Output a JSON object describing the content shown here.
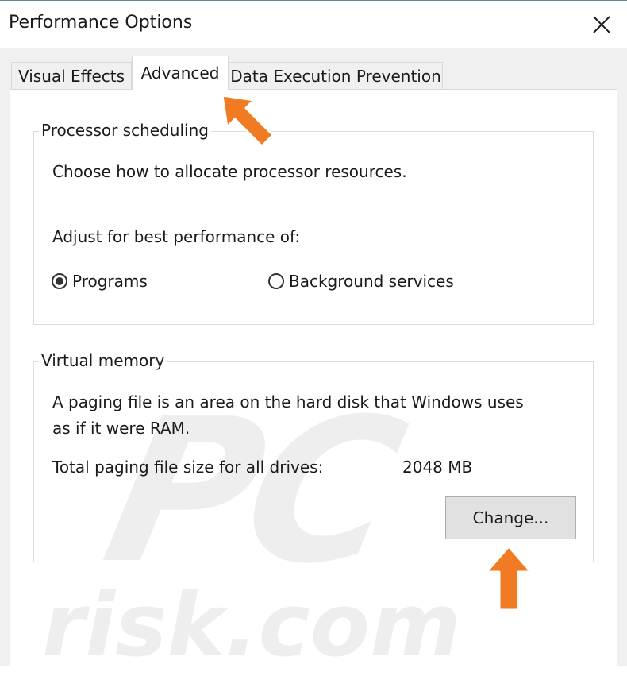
{
  "window": {
    "title": "Performance Options",
    "close_icon": "close-icon"
  },
  "tabs": [
    {
      "label": "Visual Effects",
      "active": false
    },
    {
      "label": "Advanced",
      "active": true
    },
    {
      "label": "Data Execution Prevention",
      "active": false
    }
  ],
  "processor": {
    "legend": "Processor scheduling",
    "description": "Choose how to allocate processor resources.",
    "adjust_label": "Adjust for best performance of:",
    "options": [
      {
        "label": "Programs",
        "selected": true
      },
      {
        "label": "Background services",
        "selected": false
      }
    ]
  },
  "virtual_memory": {
    "legend": "Virtual memory",
    "description_line1": "A paging file is an area on the hard disk that Windows uses",
    "description_line2": "as if it were RAM.",
    "total_label": "Total paging file size for all drives:",
    "total_value": "2048 MB",
    "change_button": "Change..."
  },
  "watermark": {
    "line1": "PC",
    "line2": "risk.com"
  },
  "colors": {
    "accent_arrow": "#f07b22",
    "arrow_outline": "#ffffff"
  }
}
